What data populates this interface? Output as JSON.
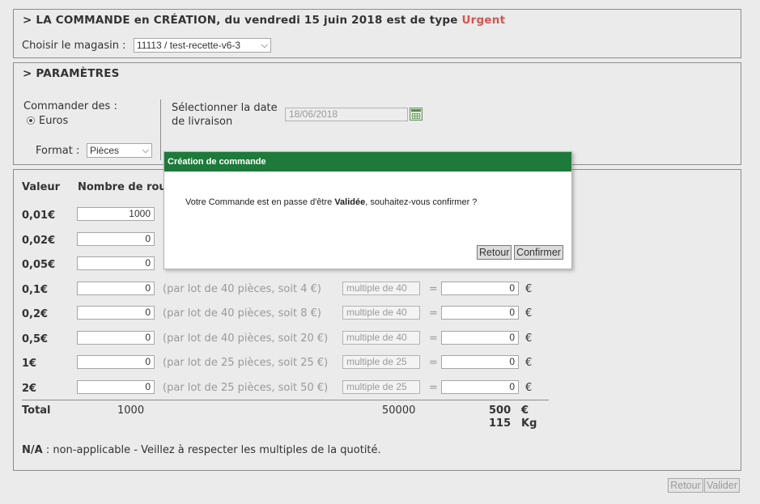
{
  "order": {
    "title_prefix": "> LA COMMANDE en CRÉATION, du vendredi 15 juin 2018 est de type",
    "title_type": "Urgent",
    "store_label": "Choisir le magasin :",
    "store_value": "11113 / test-recette-v6-3"
  },
  "params": {
    "title": "> PARAMÈTRES",
    "order_in_label": "Commander des :",
    "order_in_option": "Euros",
    "format_label": "Format :",
    "format_value": "Pièces",
    "date_label_1": "Sélectionner la date",
    "date_label_2": "de livraison",
    "date_value": "18/06/2018"
  },
  "table": {
    "col_value": "Valeur",
    "col_rolls": "Nombre de rou",
    "rows": [
      {
        "label": "0,01€",
        "qty": "1000",
        "hint": "",
        "multiple": "",
        "total": "",
        "unit": ""
      },
      {
        "label": "0,02€",
        "qty": "0",
        "hint": "",
        "multiple": "",
        "total": "",
        "unit": ""
      },
      {
        "label": "0,05€",
        "qty": "0",
        "hint": "",
        "multiple": "",
        "total": "",
        "unit": ""
      },
      {
        "label": "0,1€",
        "qty": "0",
        "hint": "(par lot de 40 pièces, soit 4 €)",
        "multiple": "multiple de 40",
        "total": "0",
        "unit": "€"
      },
      {
        "label": "0,2€",
        "qty": "0",
        "hint": "(par lot de 40 pièces, soit 8 €)",
        "multiple": "multiple de 40",
        "total": "0",
        "unit": "€"
      },
      {
        "label": "0,5€",
        "qty": "0",
        "hint": "(par lot de 40 pièces, soit 20 €)",
        "multiple": "multiple de 40",
        "total": "0",
        "unit": "€"
      },
      {
        "label": "1€",
        "qty": "0",
        "hint": "(par lot de 25 pièces, soit 25 €)",
        "multiple": "multiple de 25",
        "total": "0",
        "unit": "€"
      },
      {
        "label": "2€",
        "qty": "0",
        "hint": "(par lot de 25 pièces, soit 50 €)",
        "multiple": "multiple de 25",
        "total": "0",
        "unit": "€"
      }
    ],
    "equals": "=",
    "total_label": "Total",
    "total_qty": "1000",
    "total_pieces": "50000",
    "total_amount": "500",
    "total_amount_unit": "€",
    "total_weight": "115",
    "total_weight_unit": "Kg",
    "note_bold": "N/A",
    "note_text": ": non-applicable - Veillez à respecter les multiples de la quotité."
  },
  "footer": {
    "back_label": "Retour",
    "validate_label": "Valider"
  },
  "dialog": {
    "title": "Création de commande",
    "msg_before": "Votre Commande est en passe d'être ",
    "msg_bold": "Validée",
    "msg_after": ", souhaitez-vous confirmer ?",
    "back_label": "Retour",
    "confirm_label": "Confirmer"
  },
  "colors": {
    "urgent": "#d9534f",
    "dialog_header": "#1d7a3a"
  }
}
